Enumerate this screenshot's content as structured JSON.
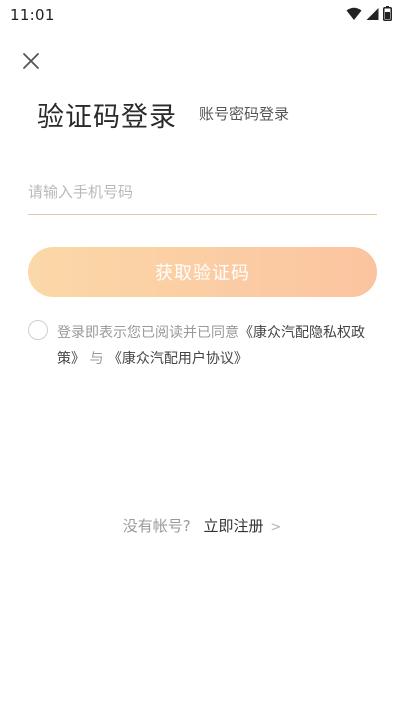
{
  "status_bar": {
    "time": "11:01",
    "icons": [
      "wifi-icon",
      "signal-icon",
      "battery-icon"
    ]
  },
  "header": {
    "close_icon": "close-icon"
  },
  "login": {
    "title": "验证码登录",
    "alt_mode_label": "账号密码登录",
    "phone_placeholder": "请输入手机号码",
    "phone_value": "",
    "get_code_label": "获取验证码"
  },
  "agreement": {
    "prefix": "登录即表示您已阅读并已同意",
    "privacy_link": "《康众汽配隐私权政策》",
    "joiner": "与",
    "user_link": "《康众汽配用户协议》",
    "checked": false
  },
  "register": {
    "prompt": "没有帐号?",
    "link_label": "立即注册",
    "chevron": ">"
  },
  "colors": {
    "button_gradient_start": "#fbd8a8",
    "button_gradient_end": "#fbc4a0",
    "input_underline": "#e3c9a8",
    "muted_text": "#999999"
  }
}
